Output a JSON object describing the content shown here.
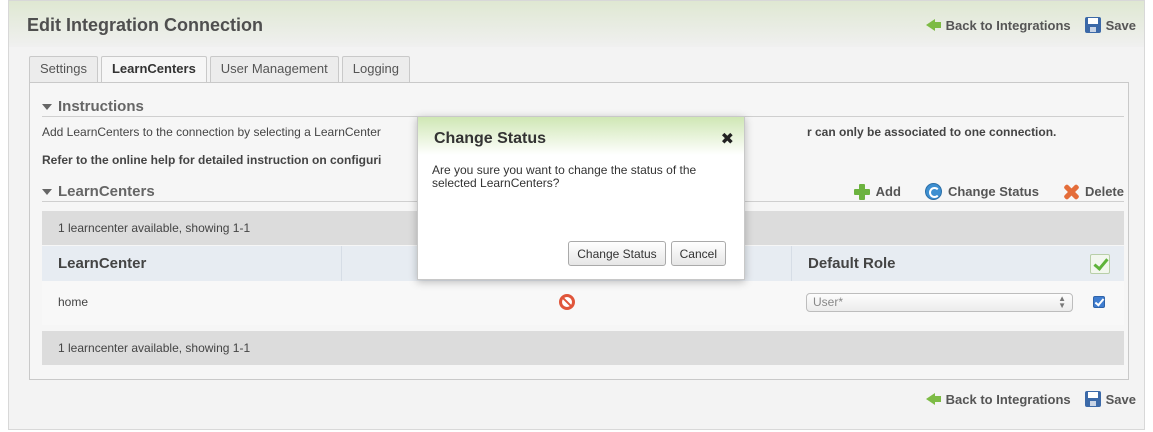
{
  "header": {
    "title": "Edit Integration Connection",
    "back_label": "Back to Integrations",
    "save_label": "Save"
  },
  "tabs": [
    {
      "label": "Settings",
      "active": false
    },
    {
      "label": "LearnCenters",
      "active": true
    },
    {
      "label": "User Management",
      "active": false
    },
    {
      "label": "Logging",
      "active": false
    }
  ],
  "instructions": {
    "title": "Instructions",
    "line1_start": "Add LearnCenters to the connection by selecting a LearnCenter",
    "line1_end": "r can only be associated to one connection.",
    "line2": "Refer to the online help for detailed instruction on configuri"
  },
  "learncenters": {
    "title": "LearnCenters",
    "add_label": "Add",
    "change_status_label": "Change Status",
    "delete_label": "Delete",
    "summary_top": "1 learncenter available, showing 1-1",
    "summary_bottom": "1 learncenter available, showing 1-1",
    "columns": [
      "LearnCenter",
      "Default Role"
    ],
    "rows": [
      {
        "name": "home",
        "status_icon": "disabled-icon",
        "default_role": "User*",
        "checked": true
      }
    ]
  },
  "footer": {
    "back_label": "Back to Integrations",
    "save_label": "Save"
  },
  "dialog": {
    "title": "Change Status",
    "close_glyph": "✖",
    "message": "Are you sure you want to change the status of the selected LearnCenters?",
    "confirm_label": "Change Status",
    "cancel_label": "Cancel"
  },
  "colors": {
    "accent_green": "#7dbb45",
    "header_blue": "#3b69a8",
    "delete_orange": "#e46d3a"
  }
}
